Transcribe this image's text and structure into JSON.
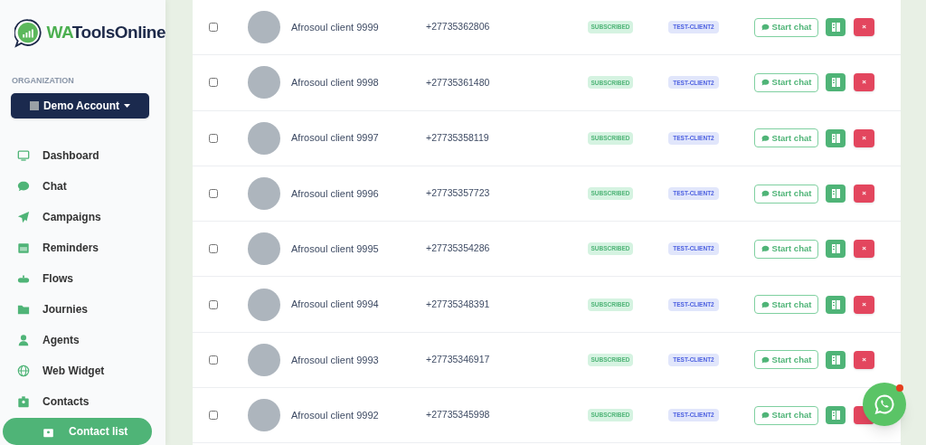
{
  "brand": {
    "prefix": "WA",
    "name": "ToolsOnline"
  },
  "organization": {
    "label": "ORGANIZATION",
    "account": "Demo Account"
  },
  "nav": [
    {
      "label": "Dashboard",
      "selected": false
    },
    {
      "label": "Chat",
      "selected": false
    },
    {
      "label": "Campaigns",
      "selected": false
    },
    {
      "label": "Reminders",
      "selected": false
    },
    {
      "label": "Flows",
      "selected": false
    },
    {
      "label": "Journies",
      "selected": false
    },
    {
      "label": "Agents",
      "selected": false
    },
    {
      "label": "Web Widget",
      "selected": false
    },
    {
      "label": "Contacts",
      "selected": false,
      "children": [
        {
          "label": "Contact list",
          "selected": true
        }
      ]
    }
  ],
  "rows": [
    {
      "checked": false,
      "name": "Afrosoul client 9999",
      "phone": "+27735362806",
      "status": "SUBSCRIBED",
      "tag": "TEST-CLIENT2",
      "action": "Start chat",
      "delete": "×"
    },
    {
      "checked": false,
      "name": "Afrosoul client 9998",
      "phone": "+27735361480",
      "status": "SUBSCRIBED",
      "tag": "TEST-CLIENT2",
      "action": "Start chat",
      "delete": "×"
    },
    {
      "checked": false,
      "name": "Afrosoul client 9997",
      "phone": "+27735358119",
      "status": "SUBSCRIBED",
      "tag": "TEST-CLIENT2",
      "action": "Start chat",
      "delete": "×"
    },
    {
      "checked": false,
      "name": "Afrosoul client 9996",
      "phone": "+27735357723",
      "status": "SUBSCRIBED",
      "tag": "TEST-CLIENT2",
      "action": "Start chat",
      "delete": "×"
    },
    {
      "checked": false,
      "name": "Afrosoul client 9995",
      "phone": "+27735354286",
      "status": "SUBSCRIBED",
      "tag": "TEST-CLIENT2",
      "action": "Start chat",
      "delete": "×"
    },
    {
      "checked": false,
      "name": "Afrosoul client 9994",
      "phone": "+27735348391",
      "status": "SUBSCRIBED",
      "tag": "TEST-CLIENT2",
      "action": "Start chat",
      "delete": "×"
    },
    {
      "checked": false,
      "name": "Afrosoul client 9993",
      "phone": "+27735346917",
      "status": "SUBSCRIBED",
      "tag": "TEST-CLIENT2",
      "action": "Start chat",
      "delete": "×"
    },
    {
      "checked": false,
      "name": "Afrosoul client 9992",
      "phone": "+27735345998",
      "status": "SUBSCRIBED",
      "tag": "TEST-CLIENT2",
      "action": "Start chat",
      "delete": ""
    }
  ],
  "chat_widget": {
    "notification": true
  }
}
